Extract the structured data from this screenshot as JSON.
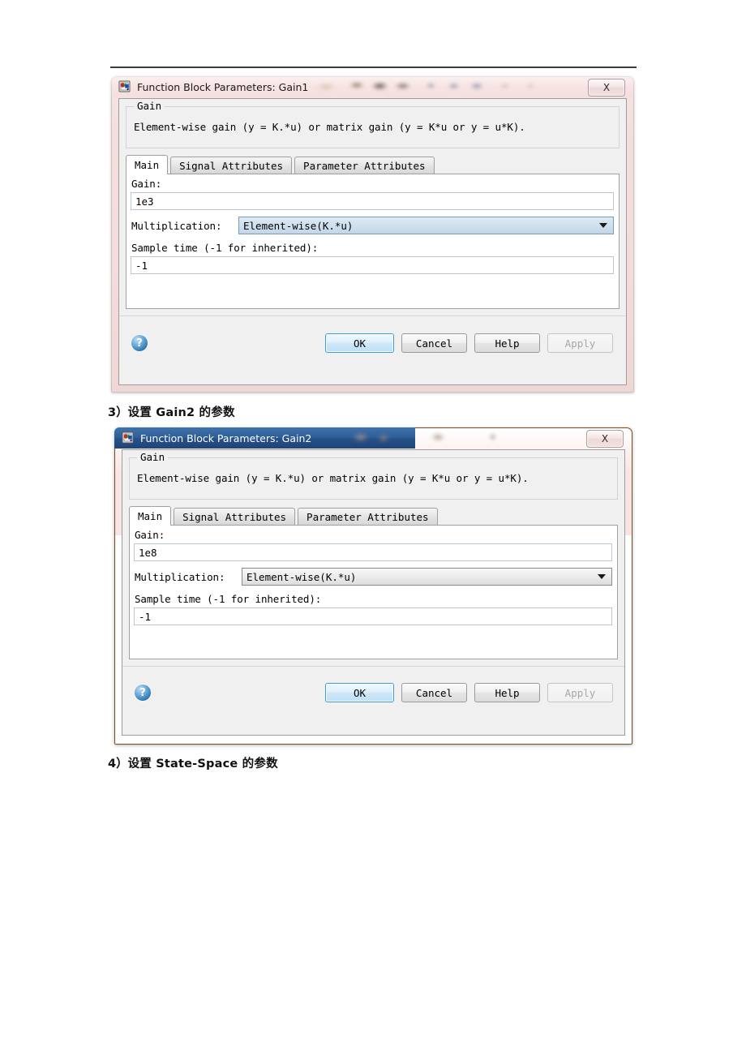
{
  "document": {
    "captions": [
      {
        "num": "3）",
        "text": "设置 Gain2 的参数"
      },
      {
        "num": "4）",
        "text": "设置 State-Space 的参数"
      }
    ]
  },
  "dialogs": [
    {
      "title": "Function Block Parameters: Gain1",
      "icon": "simulink-block-icon",
      "close_label": "✕",
      "close_glyph": "X",
      "group": {
        "legend": "Gain",
        "description": "Element-wise gain (y = K.*u) or matrix gain (y = K*u or y = u*K)."
      },
      "tabs": [
        {
          "label": "Main",
          "active": true
        },
        {
          "label": "Signal Attributes",
          "active": false
        },
        {
          "label": "Parameter Attributes",
          "active": false
        }
      ],
      "fields": {
        "gain_label": "Gain:",
        "gain_value": "1e3",
        "multiplication_label": "Multiplication:",
        "multiplication_value": "Element-wise(K.*u)",
        "sample_time_label": "Sample time (-1 for inherited):",
        "sample_time_value": "-1"
      },
      "buttons": {
        "help_icon": "?",
        "ok": "OK",
        "cancel": "Cancel",
        "help": "Help",
        "apply": "Apply"
      }
    },
    {
      "title": "Function Block Parameters: Gain2",
      "icon": "simulink-block-icon",
      "close_label": "✕",
      "close_glyph": "X",
      "group": {
        "legend": "Gain",
        "description": "Element-wise gain (y = K.*u) or matrix gain (y = K*u or y = u*K)."
      },
      "tabs": [
        {
          "label": "Main",
          "active": true
        },
        {
          "label": "Signal Attributes",
          "active": false
        },
        {
          "label": "Parameter Attributes",
          "active": false
        }
      ],
      "fields": {
        "gain_label": "Gain:",
        "gain_value": "1e8",
        "multiplication_label": "Multiplication:",
        "multiplication_value": "Element-wise(K.*u)",
        "sample_time_label": "Sample time (-1 for inherited):",
        "sample_time_value": "-1"
      },
      "buttons": {
        "help_icon": "?",
        "ok": "OK",
        "cancel": "Cancel",
        "help": "Help",
        "apply": "Apply"
      }
    }
  ],
  "colors": {
    "accent_blue": "#3c9cd6",
    "titlebar_blue": "#2f5e96",
    "dialog_face": "#f0f0f0",
    "frame_pink": "#f3dcdb",
    "frame_orange": "#c5853f"
  }
}
